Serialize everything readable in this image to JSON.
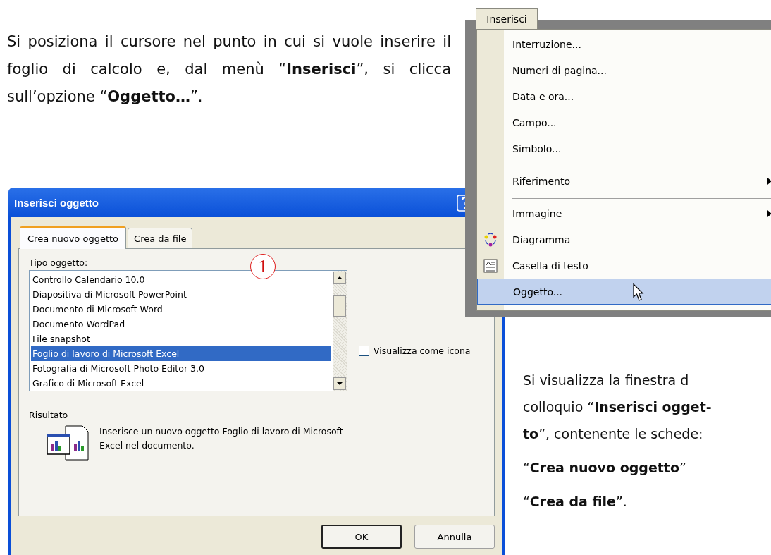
{
  "intro_text": "Si posiziona il cursore nel punto in cui si vuole inserire il foglio di calcolo e, dal menù “**Inserisci**”, si clicca sull’opzione “**Oggetto…**”.",
  "menu": {
    "title": "Inserisci",
    "items": [
      {
        "label": "Interruzione...",
        "kind": "plain",
        "submenu": false,
        "separator_before": false,
        "selected": false
      },
      {
        "label": "Numeri di pagina...",
        "kind": "plain",
        "submenu": false,
        "separator_before": false,
        "selected": false
      },
      {
        "label": "Data e ora...",
        "kind": "plain",
        "submenu": false,
        "separator_before": false,
        "selected": false
      },
      {
        "label": "Campo...",
        "kind": "plain",
        "submenu": false,
        "separator_before": false,
        "selected": false
      },
      {
        "label": "Simbolo...",
        "kind": "plain",
        "submenu": false,
        "separator_before": false,
        "selected": false
      },
      {
        "label": "Riferimento",
        "kind": "plain",
        "submenu": true,
        "separator_before": true,
        "selected": false
      },
      {
        "label": "Immagine",
        "kind": "plain",
        "submenu": true,
        "separator_before": true,
        "selected": false
      },
      {
        "label": "Diagramma",
        "kind": "diagram",
        "submenu": false,
        "separator_before": false,
        "selected": false
      },
      {
        "label": "Casella di testo",
        "kind": "textbox",
        "submenu": false,
        "separator_before": false,
        "selected": false
      },
      {
        "label": "Oggetto...",
        "kind": "plain",
        "submenu": false,
        "separator_before": false,
        "selected": true
      }
    ]
  },
  "dialog": {
    "title": "Inserisci oggetto",
    "tabs": [
      {
        "label": "Crea nuovo oggetto",
        "selected": true
      },
      {
        "label": "Crea da file",
        "selected": false
      }
    ],
    "list_label": "Tipo oggetto:",
    "list_items": [
      {
        "label": "Controllo Calendario 10.0",
        "selected": false
      },
      {
        "label": "Diapositiva di Microsoft PowerPoint",
        "selected": false
      },
      {
        "label": "Documento di Microsoft Word",
        "selected": false
      },
      {
        "label": "Documento WordPad",
        "selected": false
      },
      {
        "label": "File snapshot",
        "selected": false
      },
      {
        "label": "Foglio di lavoro di Microsoft Excel",
        "selected": true
      },
      {
        "label": "Fotografia di Microsoft Photo Editor 3.0",
        "selected": false
      },
      {
        "label": "Grafico di Microsoft Excel",
        "selected": false
      }
    ],
    "checkbox": {
      "label": "Visualizza come icona",
      "checked": false
    },
    "result_label": "Risultato",
    "result_text": "Inserisce un nuovo oggetto Foglio di lavoro di Microsoft Excel nel documento.",
    "buttons": [
      {
        "label": "OK",
        "default": true
      },
      {
        "label": "Annulla",
        "default": false
      }
    ]
  },
  "annotation_marker": "1",
  "side_text_lines": [
    "Si visualizza la finestra d",
    "colloquio “**Inserisci ogget-**",
    "**to**”, contenente le schede:"
  ],
  "tab_names": [
    "“**Crea nuovo oggetto**”",
    "“**Crea da file**”."
  ]
}
